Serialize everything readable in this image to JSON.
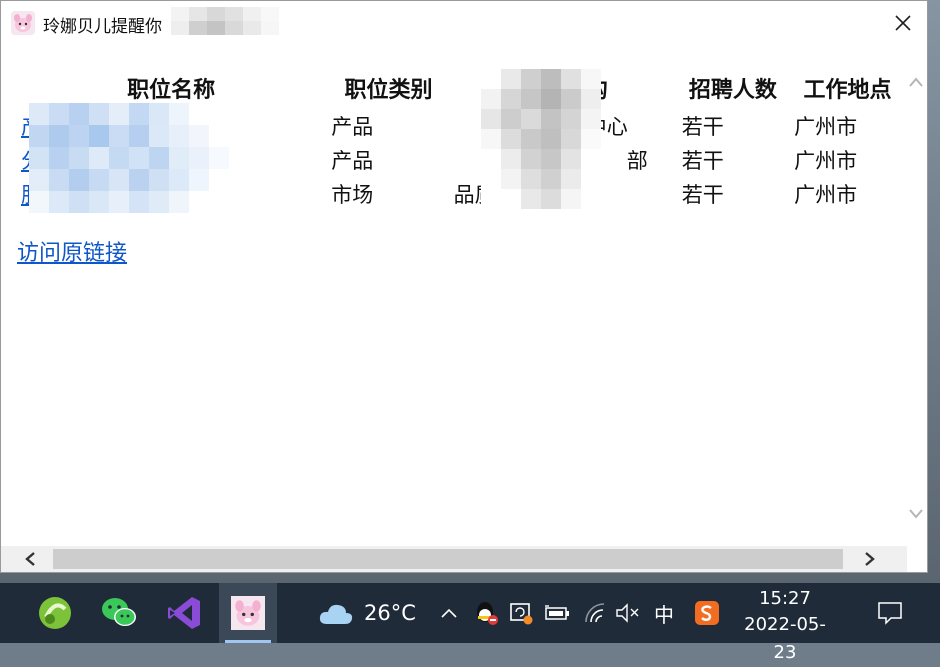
{
  "window": {
    "title": "玲娜贝儿提醒你"
  },
  "table": {
    "headers": [
      "职位名称",
      "职位类别",
      "所属机构",
      "招聘人数",
      "工作地点"
    ],
    "rows": [
      {
        "name": "产品运营",
        "category": "产品",
        "org": "中心",
        "count": "若干",
        "location": "广州市"
      },
      {
        "name": "分析 2022",
        "category": "产品",
        "org": "部",
        "count": "若干",
        "location": "广州市"
      },
      {
        "name": "服务运",
        "category": "市场",
        "org": "品质",
        "count": "若干",
        "location": "广州市"
      }
    ]
  },
  "original_link": "访问原链接",
  "taskbar": {
    "weather_temp": "26°C",
    "ime": "中",
    "time": "15:27",
    "date": "2022-05-23",
    "apps": [
      "vcs-icon",
      "wechat-icon",
      "visual-studio-icon",
      "linabell-app-icon"
    ]
  },
  "colors": {
    "link": "#0f57c9",
    "taskbar_bg": "#1f2b38",
    "visual_studio": "#8a4bd6",
    "wechat": "#3ac858",
    "sogou": "#f26d21"
  }
}
